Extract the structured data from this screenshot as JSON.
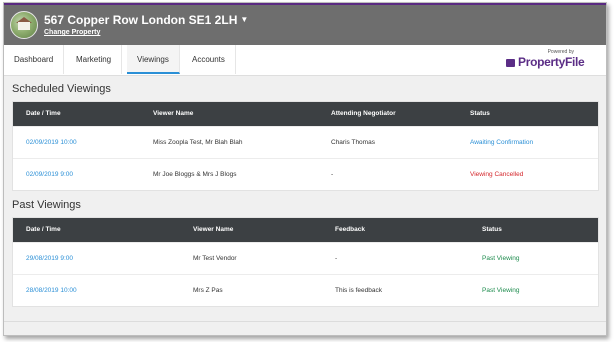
{
  "property": {
    "title": "567 Copper Row London SE1 2LH",
    "change_link": "Change Property"
  },
  "tabs": [
    {
      "label": "Dashboard"
    },
    {
      "label": "Marketing"
    },
    {
      "label": "Viewings",
      "active": true
    },
    {
      "label": "Accounts"
    }
  ],
  "brand": {
    "powered_by": "Powered by",
    "name": "PropertyFile",
    "color": "#5b2d86"
  },
  "scheduled": {
    "title": "Scheduled Viewings",
    "columns": [
      "Date / Time",
      "Viewer Name",
      "Attending Negotiator",
      "Status"
    ],
    "rows": [
      {
        "datetime": "02/09/2019 10:00",
        "viewer": "Miss Zoopla Test, Mr Blah Blah",
        "negotiator": "Charis Thomas",
        "status": "Awaiting Confirmation"
      },
      {
        "datetime": "02/09/2019 9:00",
        "viewer": "Mr Joe Bloggs & Mrs J Blogs",
        "negotiator": "-",
        "status": "Viewing Cancelled"
      }
    ]
  },
  "past": {
    "title": "Past Viewings",
    "columns": [
      "Date / Time",
      "Viewer Name",
      "Feedback",
      "Status"
    ],
    "rows": [
      {
        "datetime": "29/08/2019 9:00",
        "viewer": "Mr Test Vendor",
        "feedback": "-",
        "status": "Past Viewing"
      },
      {
        "datetime": "28/08/2019 10:00",
        "viewer": "Mrs Z Pas",
        "feedback": "This is feedback",
        "status": "Past Viewing"
      }
    ]
  },
  "colors": {
    "accent": "#2a8fd6",
    "header_dark": "#3c4043",
    "status_awaiting": "#2a8fd6",
    "status_cancelled": "#d4272c",
    "status_past": "#1e8c4e"
  }
}
